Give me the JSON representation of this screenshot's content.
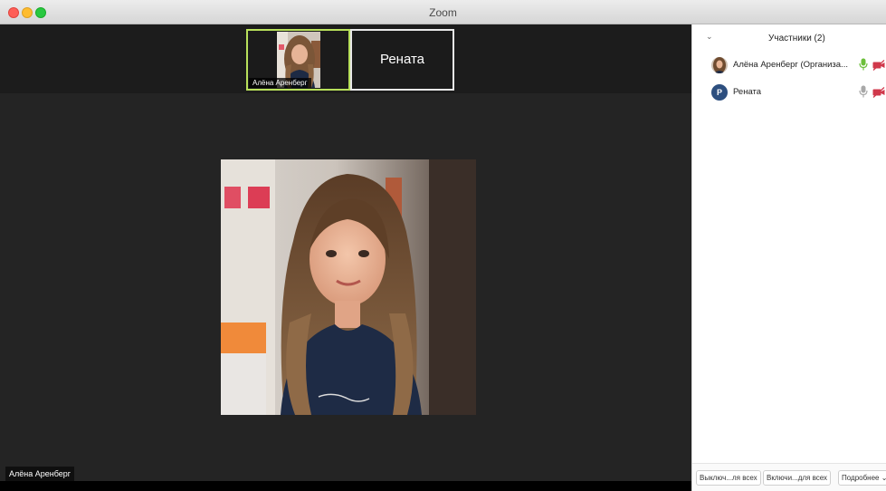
{
  "window": {
    "title": "Zoom"
  },
  "gallery": {
    "tiles": [
      {
        "name": "Алёна Аренберг",
        "active": true,
        "highlight_color": "#b8e05b"
      },
      {
        "name": "Рената",
        "active": false
      }
    ]
  },
  "main_video": {
    "speaker_name": "Алёна Аренберг"
  },
  "participants_panel": {
    "title": "Участники (2)",
    "participants": [
      {
        "name": "Алёна Аренберг (Организа...",
        "avatar": "photo",
        "mic": "on",
        "video": "off"
      },
      {
        "name": "Рената",
        "avatar_letter": "Р",
        "mic": "off",
        "video": "off"
      }
    ],
    "footer": {
      "mute_all": "Выключ...ля всех",
      "unmute_all": "Включи...для всех",
      "more": "Подробнее"
    }
  },
  "colors": {
    "accent_mic": "#6cbf3a",
    "video_off": "#d0384b",
    "avatar_bg": "#2d4f7f"
  }
}
